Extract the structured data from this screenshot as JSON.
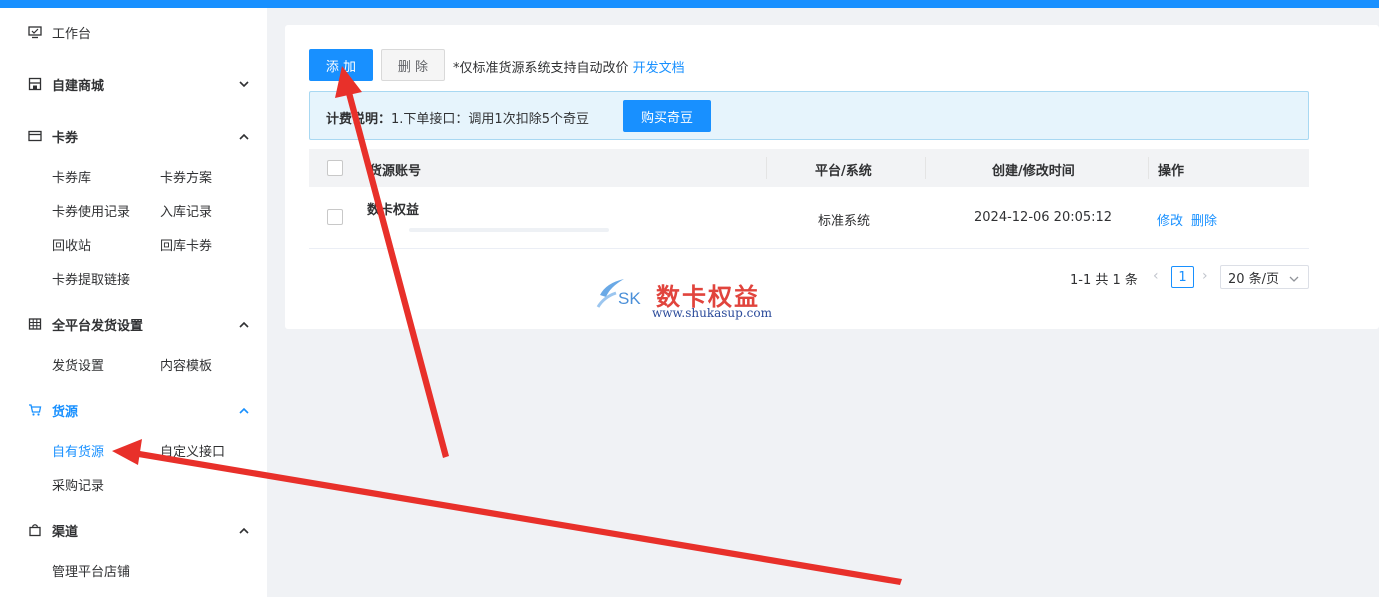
{
  "sidebar": {
    "workbench": "工作台",
    "self_mall": "自建商城",
    "coupon": {
      "title": "卡券",
      "items": [
        "卡券库",
        "卡券方案",
        "卡券使用记录",
        "入库记录",
        "回收站",
        "回库卡券",
        "卡券提取链接"
      ]
    },
    "delivery": {
      "title": "全平台发货设置",
      "items": [
        "发货设置",
        "内容模板"
      ]
    },
    "supply": {
      "title": "货源",
      "items": [
        "自有货源",
        "自定义接口",
        "采购记录"
      ]
    },
    "channel": {
      "title": "渠道",
      "items": [
        "管理平台店铺"
      ]
    }
  },
  "toolbar": {
    "add_label": "添 加",
    "delete_label": "删 除",
    "note": "*仅标准货源系统支持自动改价",
    "doc_link": "开发文档"
  },
  "billing": {
    "label": "计费说明：",
    "text": "1.下单接口：调用1次扣除5个奇豆",
    "buy_label": "购买奇豆"
  },
  "table": {
    "columns": [
      "货源账号",
      "平台/系统",
      "创建/修改时间",
      "操作"
    ],
    "rows": [
      {
        "account": "数卡权益",
        "platform": "标准系统",
        "time": "2024-12-06 20:05:12",
        "edit": "修改",
        "delete": "删除"
      }
    ]
  },
  "pagination": {
    "summary": "1-1 共 1 条",
    "current_page": "1",
    "page_size": "20 条/页"
  },
  "watermark": {
    "logo_text": "SK",
    "name": "数卡权益",
    "url": "www.shukasup.com"
  },
  "colors": {
    "primary": "#1890ff",
    "annotation_arrow": "#e8302a"
  }
}
